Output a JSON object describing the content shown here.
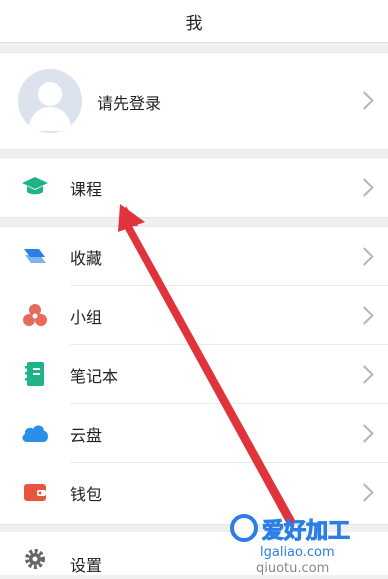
{
  "header": {
    "title": "我"
  },
  "profile": {
    "login_prompt": "请先登录"
  },
  "menu": {
    "course": {
      "label": "课程",
      "icon": "graduation-cap-icon",
      "color": "#1fb38a"
    },
    "items": [
      {
        "label": "收藏",
        "icon": "bookmark-icon",
        "color": "#2a7ee6"
      },
      {
        "label": "小组",
        "icon": "group-icon",
        "color": "#e86a5a"
      },
      {
        "label": "笔记本",
        "icon": "notebook-icon",
        "color": "#1fb38a"
      },
      {
        "label": "云盘",
        "icon": "cloud-icon",
        "color": "#2a8fe6"
      },
      {
        "label": "钱包",
        "icon": "wallet-icon",
        "color": "#e8553d"
      }
    ],
    "settings": {
      "label": "设置",
      "icon": "gear-icon"
    }
  },
  "annotation": {
    "arrow_color": "#e0343c"
  },
  "watermark": {
    "text": "爱好加工",
    "subtext": "lgaliao.com",
    "bottom_text": "qiuotu.com"
  }
}
